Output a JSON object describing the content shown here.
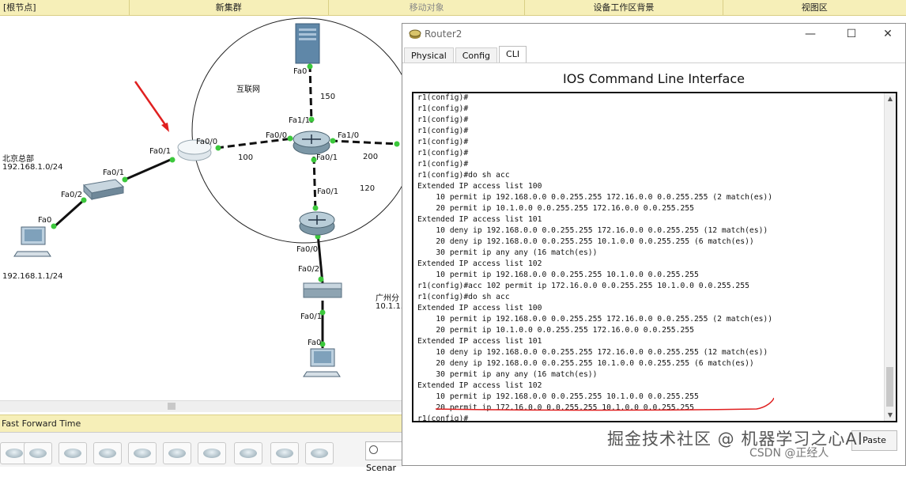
{
  "topbar": {
    "root": "[根节点]",
    "new_cluster": "新集群",
    "move_object": "移动对象",
    "set_background": "设备工作区背景",
    "viewport": "视图区"
  },
  "topology": {
    "labels": {
      "cloud": "互联网",
      "beijing_name": "北京总部",
      "beijing_net": "192.168.1.0/24",
      "pc_ip": "192.168.1.1/24",
      "guangzhou_name": "广州分",
      "guangzhou_net": "10.1.1.",
      "l150": "150",
      "l100": "100",
      "l200": "200",
      "l120": "120"
    },
    "ports": {
      "srv_fa0": "Fa0",
      "fa11": "Fa1/1",
      "fa10_r": "Fa1/0",
      "fa00_c": "Fa0/0",
      "fa00_l": "Fa0/0",
      "fa01_l": "Fa0/1",
      "sw_fa01": "Fa0/1",
      "sw_fa02": "Fa0/2",
      "pc_fa0": "Fa0",
      "c_fa01": "Fa0/1",
      "b_fa01": "Fa0/1",
      "b_fa00": "Fa0/0",
      "sw2_fa02": "Fa0/2",
      "sw2_fa01": "Fa0/1",
      "pc2_fa0": "Fa0"
    }
  },
  "bottom": {
    "ff_label": "Fast Forward Time",
    "scenario": "Scenar"
  },
  "window": {
    "title": "Router2",
    "tabs": [
      "Physical",
      "Config",
      "CLI"
    ],
    "active_tab": "CLI",
    "heading": "IOS Command Line Interface",
    "paste": "Paste",
    "annotation_color": "#e02020"
  },
  "cli": [
    "r1(config)#",
    "r1(config)#",
    "r1(config)#",
    "r1(config)#",
    "r1(config)#",
    "r1(config)#",
    "r1(config)#",
    "r1(config)#do sh acc",
    "Extended IP access list 100",
    "    10 permit ip 192.168.0.0 0.0.255.255 172.16.0.0 0.0.255.255 (2 match(es))",
    "    20 permit ip 10.1.0.0 0.0.255.255 172.16.0.0 0.0.255.255",
    "Extended IP access list 101",
    "    10 deny ip 192.168.0.0 0.0.255.255 172.16.0.0 0.0.255.255 (12 match(es))",
    "    20 deny ip 192.168.0.0 0.0.255.255 10.1.0.0 0.0.255.255 (6 match(es))",
    "    30 permit ip any any (16 match(es))",
    "Extended IP access list 102",
    "    10 permit ip 192.168.0.0 0.0.255.255 10.1.0.0 0.0.255.255",
    "r1(config)#acc 102 permit ip 172.16.0.0 0.0.255.255 10.1.0.0 0.0.255.255",
    "r1(config)#do sh acc",
    "Extended IP access list 100",
    "    10 permit ip 192.168.0.0 0.0.255.255 172.16.0.0 0.0.255.255 (2 match(es))",
    "    20 permit ip 10.1.0.0 0.0.255.255 172.16.0.0 0.0.255.255",
    "Extended IP access list 101",
    "    10 deny ip 192.168.0.0 0.0.255.255 172.16.0.0 0.0.255.255 (12 match(es))",
    "    20 deny ip 192.168.0.0 0.0.255.255 10.1.0.0 0.0.255.255 (6 match(es))",
    "    30 permit ip any any (16 match(es))",
    "Extended IP access list 102",
    "    10 permit ip 192.168.0.0 0.0.255.255 10.1.0.0 0.0.255.255",
    "    20 permit ip 172.16.0.0 0.0.255.255 10.1.0.0 0.0.255.255",
    "r1(config)#"
  ],
  "watermark": {
    "main": "掘金技术社区 @ 机器学习之心AI",
    "sub": "CSDN @正经人"
  }
}
